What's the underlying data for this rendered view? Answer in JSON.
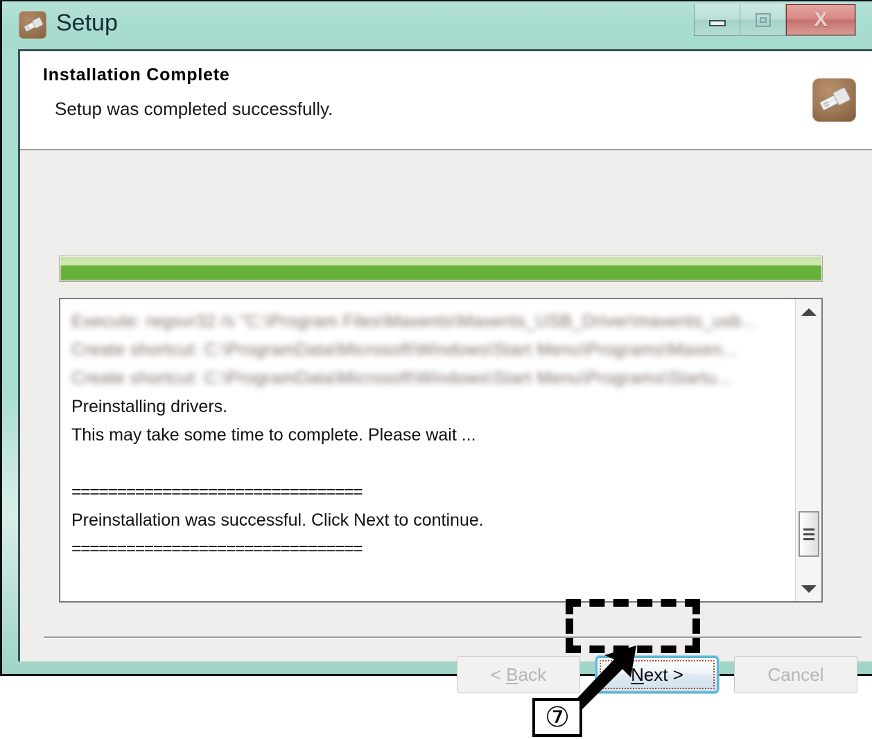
{
  "window": {
    "title": "Setup",
    "icon": "usb-drive-icon",
    "controls": {
      "minimize": "minimize-icon",
      "maximize": "maximize-icon",
      "close": "X"
    },
    "titlebar_color": "#a9ddd1"
  },
  "header": {
    "title": "Installation Complete",
    "subtitle": "Setup was completed successfully.",
    "icon": "usb-drive-icon"
  },
  "progress": {
    "percent": 100,
    "fill_color": "#6cb33f"
  },
  "log": {
    "lines": [
      {
        "text": "Execute: regsvr32 /s \"C:\\Program Files\\Maxents\\Maxents_USB_Driver\\maxents_usb...",
        "redacted": true
      },
      {
        "text": "Create shortcut: C:\\ProgramData\\Microsoft\\Windows\\Start Menu\\Programs\\Maxen...",
        "redacted": true
      },
      {
        "text": "Create shortcut: C:\\ProgramData\\Microsoft\\Windows\\Start Menu\\Programs\\Startu...",
        "redacted": true
      },
      {
        "text": "Preinstalling drivers.",
        "redacted": false
      },
      {
        "text": "This may take some time to complete. Please wait ...",
        "redacted": false
      },
      {
        "text": "",
        "redacted": false
      },
      {
        "text": "================================",
        "redacted": false
      },
      {
        "text": "Preinstallation was successful. Click Next to continue.",
        "redacted": false
      },
      {
        "text": "================================",
        "redacted": false
      }
    ],
    "scrollbar": {
      "up_arrow": "scroll-up-icon",
      "down_arrow": "scroll-down-icon"
    }
  },
  "footer": {
    "back_label": "< Back",
    "back_accel": "B",
    "next_label": "Next >",
    "next_accel": "N",
    "cancel_label": "Cancel",
    "back_enabled": false,
    "next_enabled": true,
    "cancel_enabled": false
  },
  "annotation": {
    "callout_number": "⑦",
    "target": "next-button"
  }
}
